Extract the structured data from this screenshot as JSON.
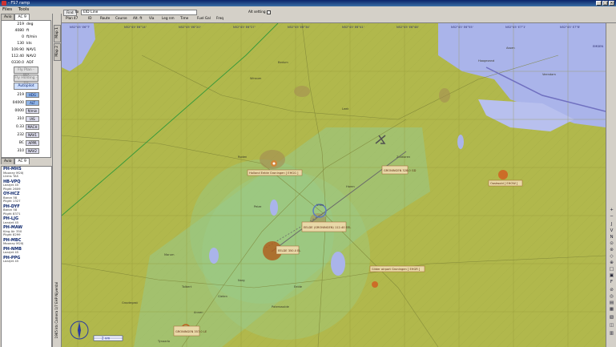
{
  "window": {
    "title": "- FS7 ramp"
  },
  "menu": {
    "items": [
      "Files",
      "Tools"
    ]
  },
  "left_tabs": [
    "Avio",
    "AC 9"
  ],
  "aircraft_state": [
    {
      "value": "219",
      "label": "deg"
    },
    {
      "value": "4080",
      "label": "ft"
    },
    {
      "value": "0",
      "label": "ft/min"
    },
    {
      "value": "130",
      "label": "kts"
    },
    {
      "value": "109.90",
      "label": "NAV1"
    },
    {
      "value": "112.40",
      "label": "NAV2"
    },
    {
      "value": "0330.0",
      "label": "ADF"
    }
  ],
  "buttons": {
    "fly_plan": "Fly Plan - WP",
    "fly_holding": "Fly Holding - FH",
    "autopilot": "Autopilot"
  },
  "ap_rows": [
    {
      "value": "219",
      "button": "HDG"
    },
    {
      "value": "04000",
      "button": "ALT"
    },
    {
      "value": "0000",
      "button": "ft/min"
    },
    {
      "value": "310",
      "button": "IAS"
    },
    {
      "value": "0.33",
      "button": "MACH"
    },
    {
      "value": "232",
      "button": "NAV1"
    },
    {
      "value": "BC",
      "button": "APPR"
    },
    {
      "value": "310",
      "button": "NAV2"
    }
  ],
  "list_tabs": [
    "Avio",
    "AC 9"
  ],
  "aircraft_list": [
    {
      "callsign": "PH-MHS",
      "lines": [
        "Mooney M20J",
        "Ltrms TAS"
      ]
    },
    {
      "callsign": "HB-VPQ",
      "lines": [
        "Learjet 45",
        "Plight 2609"
      ]
    },
    {
      "callsign": "OY-HCZ",
      "lines": [
        "Baron 58",
        "Plight 1327"
      ]
    },
    {
      "callsign": "PH-DYF",
      "lines": [
        "Baron 58",
        "Plight 8371"
      ]
    },
    {
      "callsign": "PH-LJG",
      "lines": [
        "Learjet 45"
      ]
    },
    {
      "callsign": "PH-MAW",
      "lines": [
        "King Air 350",
        "Plight 8299"
      ]
    },
    {
      "callsign": "PH-MBC",
      "lines": [
        "Mooney M20J"
      ]
    },
    {
      "callsign": "PH-NMB",
      "lines": [
        "Learjet 45"
      ]
    },
    {
      "callsign": "PH-PPG",
      "lines": [
        "Learjet 45"
      ]
    }
  ],
  "vertical_tabs": [
    "Map 1",
    "Map 2"
  ],
  "vertical_status": "1965 kts  Camera 1/7 EHP  Nijverdal",
  "toolbar": {
    "find_label": "Find",
    "plan_label": "Plan",
    "plan_value": "47",
    "to_label": "to",
    "id_line": "EID Line",
    "alt_label": "Alt setting",
    "columns": [
      "ID",
      "Route",
      "Course",
      "Alt. ft",
      "Via",
      "Leg nm",
      "Time",
      "Fuel Gal",
      "Freq"
    ]
  },
  "map": {
    "colors": {
      "land": "#b1b84c",
      "water": "#aab4ea",
      "zone": "#97c98a",
      "accent": "#d35a1e"
    },
    "grid_top_labels": [
      "N52°45' E6°7'",
      "N52°45' E6°14'",
      "N52°45' E6°20'",
      "N52°45' E6°27'",
      "N52°45' E6°34'",
      "N52°45' E6°41'",
      "N52°45' E6°48'",
      "N52°45' E6°55'",
      "N52°45' E7°1'",
      "N52°45' E7°8'"
    ],
    "places": [
      "Assen",
      "Hoogezand",
      "Veendam",
      "Bedum",
      "Winsum",
      "Leek",
      "Roden",
      "Peize",
      "Vries",
      "Haren",
      "Zuidlaren",
      "Marum",
      "Tolbert",
      "Grootegast",
      "Norg",
      "Gieten",
      "Annen",
      "Eelde",
      "Paterswolde",
      "Tynaarlo"
    ],
    "labels": {
      "eelde_ap": "Holland Eelde Groningen [ EHGG ]",
      "oostwold": "Oostwold [ EHOW ]",
      "glider": "Glider airport Groningen [ EHGR ]",
      "vor_label": "EELDE (GRONINGEN) 112.40 EEL",
      "vor_freq": "GRONINGEN 328.0 GD",
      "ndb_label": "EELDE 350.0 EL",
      "ndb_bottom": "GRONINGEN 357.0 LE",
      "emden": "EMDEN",
      "scale": "2 nm"
    }
  }
}
